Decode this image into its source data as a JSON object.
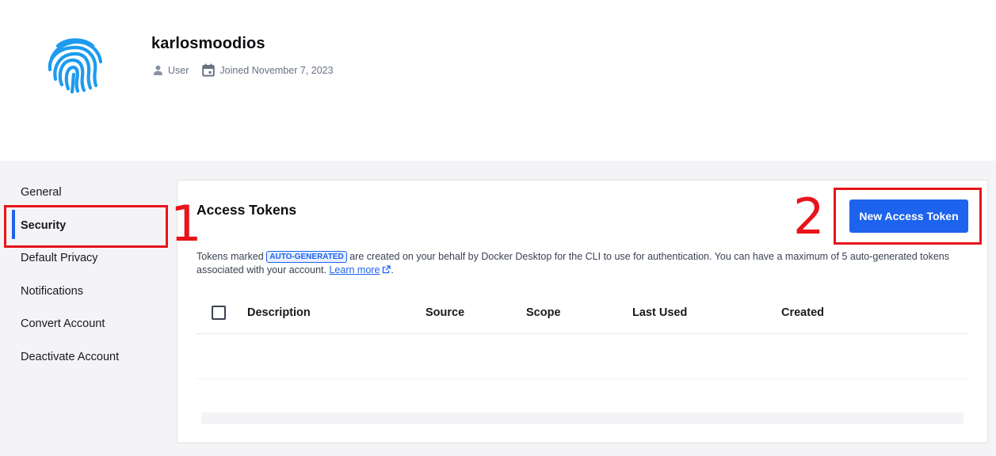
{
  "profile": {
    "username": "karlosmoodios",
    "role": "User",
    "joined": "Joined November 7, 2023",
    "avatar_icon": "fingerprint-icon"
  },
  "sidebar": {
    "items": [
      {
        "label": "General",
        "active": false
      },
      {
        "label": "Security",
        "active": true
      },
      {
        "label": "Default Privacy",
        "active": false
      },
      {
        "label": "Notifications",
        "active": false
      },
      {
        "label": "Convert Account",
        "active": false
      },
      {
        "label": "Deactivate Account",
        "active": false
      }
    ]
  },
  "access_tokens": {
    "title": "Access Tokens",
    "new_button_label": "New Access Token",
    "desc_prefix": "Tokens marked",
    "badge": "AUTO-GENERATED",
    "desc_suffix": "are created on your behalf by Docker Desktop for the CLI to use for authentication. You can have a maximum of 5 auto-generated tokens associated with your account.",
    "learn_more": "Learn more",
    "table": {
      "columns": [
        "Description",
        "Source",
        "Scope",
        "Last Used",
        "Created"
      ],
      "rows": []
    }
  },
  "annotations": [
    "1",
    "2"
  ],
  "colors": {
    "accent": "#1d63ed",
    "annotation": "#e8141b",
    "avatar": "#1d9bf0"
  }
}
